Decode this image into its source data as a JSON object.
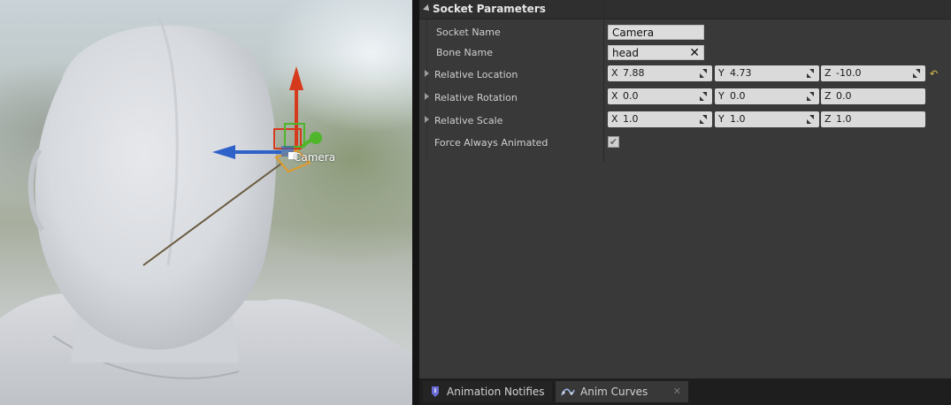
{
  "viewport": {
    "socket_label": "Camera"
  },
  "details": {
    "section_title": "Socket Parameters",
    "socket_name": {
      "label": "Socket Name",
      "value": "Camera"
    },
    "bone_name": {
      "label": "Bone Name",
      "value": "head"
    },
    "relative_location": {
      "label": "Relative Location",
      "x": "7.88",
      "y": "4.73",
      "z": "-10.0"
    },
    "relative_rotation": {
      "label": "Relative Rotation",
      "x": "0.0",
      "y": "0.0",
      "z": "0.0"
    },
    "relative_scale": {
      "label": "Relative Scale",
      "x": "1.0",
      "y": "1.0",
      "z": "1.0"
    },
    "force_always_animated": {
      "label": "Force Always Animated",
      "checked": true
    },
    "axis_x": "X",
    "axis_y": "Y",
    "axis_z": "Z"
  },
  "tabs": [
    {
      "label": "Animation Notifies",
      "icon": "notify-icon"
    },
    {
      "label": "Anim Curves",
      "icon": "curves-icon"
    }
  ],
  "colors": {
    "panel_bg": "#393939",
    "gizmo_x": "#2f62c9",
    "gizmo_y": "#4fb52a",
    "gizmo_z": "#d63a1c",
    "reset_arrow": "#e3c44a"
  }
}
